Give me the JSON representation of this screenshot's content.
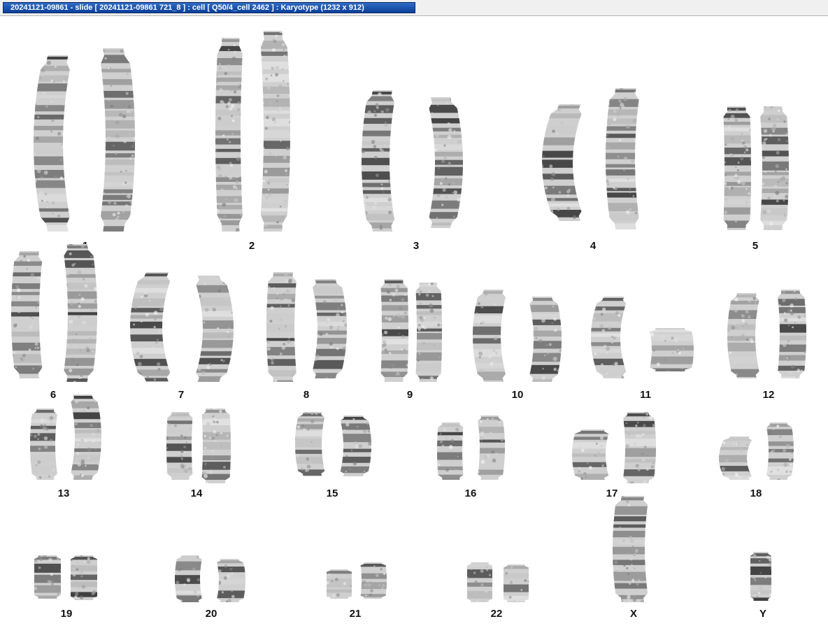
{
  "window": {
    "title": "20241121-09861 - slide [ 20241121-09861 721_8 ] : cell [ Q50/4_cell 2462 ] : Karyotype  (1232 x 912)"
  },
  "colors": {
    "background": "#ffffff",
    "title_bar": "#0a3f9a",
    "chromatin_dark": "#1a1a1a",
    "chromatin_light": "#d8d8d8"
  },
  "karyotype": {
    "labels": {
      "c1": "1",
      "c2": "2",
      "c3": "3",
      "c4": "4",
      "c5": "5",
      "c6": "6",
      "c7": "7",
      "c8": "8",
      "c9": "9",
      "c10": "10",
      "c11": "11",
      "c12": "12",
      "c13": "13",
      "c14": "14",
      "c15": "15",
      "c16": "16",
      "c17": "17",
      "c18": "18",
      "c19": "19",
      "c20": "20",
      "c21": "21",
      "c22": "22",
      "cX": "X",
      "cY": "Y"
    }
  }
}
